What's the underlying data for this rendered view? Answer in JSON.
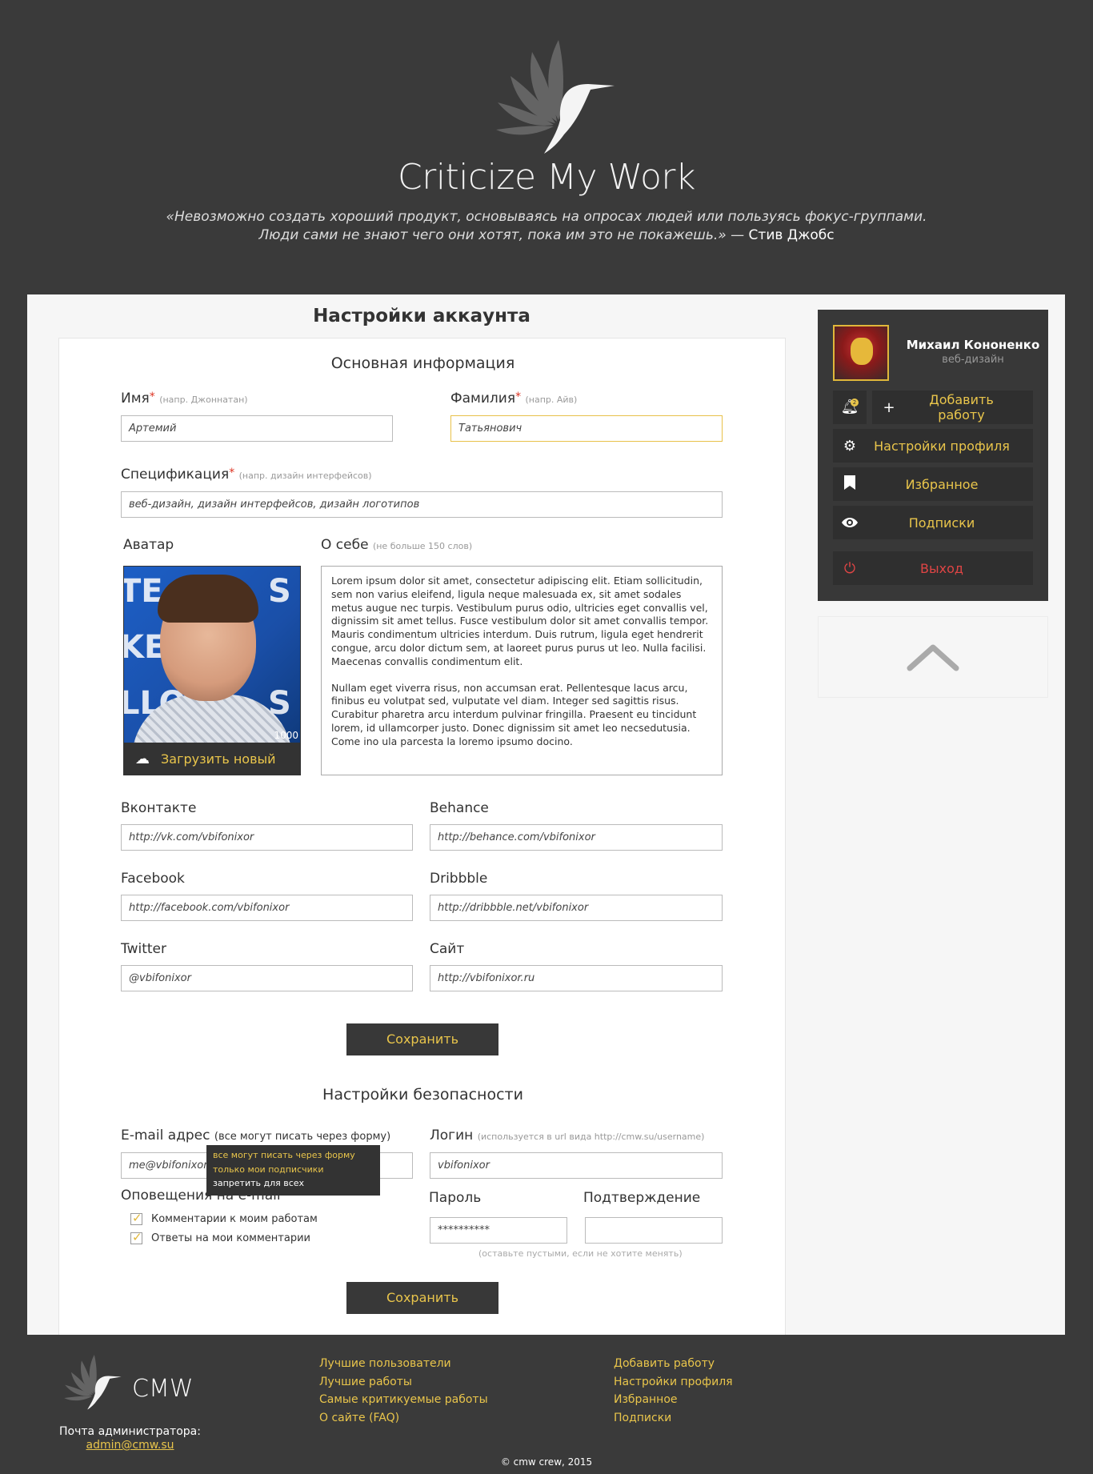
{
  "header": {
    "site_title": "Criticize My Work",
    "quote_text": "«Невозможно создать хороший продукт, основываясь на опросах людей или пользуясь фокус-группами. Люди сами не знают чего они хотят, пока им это не покажешь.» —",
    "quote_author": "Стив Джобс"
  },
  "page_title": "Настройки аккаунта",
  "basic": {
    "section_title": "Основная информация",
    "first_name_label": "Имя",
    "first_name_hint": "(напр. Джоннатан)",
    "first_name_value": "Артемий",
    "last_name_label": "Фамилия",
    "last_name_hint": "(напр. Айв)",
    "last_name_value": "Татьянович",
    "spec_label": "Спецификация",
    "spec_hint": "(напр. дизайн интерфейсов)",
    "spec_value": "веб-дизайн, дизайн интерфейсов, дизайн логотипов",
    "avatar_label": "Аватар",
    "avatar_badge": "1000",
    "upload_label": "Загрузить новый",
    "about_label": "О себе",
    "about_hint": "(не больше 150 слов)",
    "about_p1": "Lorem ipsum dolor sit amet, consectetur adipiscing elit. Etiam sollicitudin, sem non varius eleifend, ligula neque malesuada ex, sit amet sodales metus augue nec turpis. Vestibulum purus odio, ultricies eget convallis vel, dignissim sit amet tellus. Fusce vestibulum dolor sit amet convallis tempor. Mauris condimentum ultricies interdum. Duis rutrum, ligula eget hendrerit congue, arcu dolor dictum sem, at laoreet purus purus ut leo. Nulla facilisi. Maecenas convallis condimentum elit.",
    "about_p2": "Nullam eget viverra risus, non accumsan erat. Pellentesque lacus arcu, finibus eu volutpat sed, vulputate vel diam. Integer sed sagittis risus. Curabitur pharetra arcu interdum pulvinar fringilla. Praesent eu tincidunt lorem, id ullamcorper justo. Donec dignissim sit amet leo necsedutusia. Come ino ula parcesta la loremo ipsumo docino."
  },
  "social": {
    "vk_label": "Вконтакте",
    "vk_value": "http://vk.com/vbifonixor",
    "behance_label": "Behance",
    "behance_value": "http://behance.com/vbifonixor",
    "facebook_label": "Facebook",
    "facebook_value": "http://facebook.com/vbifonixor",
    "dribbble_label": "Dribbble",
    "dribbble_value": "http://dribbble.net/vbifonixor",
    "twitter_label": "Twitter",
    "twitter_value": "@vbifonixor",
    "site_label": "Сайт",
    "site_value": "http://vbifonixor.ru"
  },
  "save_label": "Сохранить",
  "security": {
    "section_title": "Настройки безопасности",
    "email_label": "E-mail адрес",
    "email_privacy_selected": "(все могут писать через форму)",
    "email_value": "me@vbifonixor.ru",
    "privacy_options": [
      "все могут писать через форму",
      "только мои подписчики",
      "запретить для всех"
    ],
    "login_label": "Логин",
    "login_hint": "(используется в url вида http://cmw.su/username)",
    "login_value": "vbifonixor",
    "notify_label": "Оповещения на e-mail",
    "notify_1": "Комментарии к моим работам",
    "notify_2": "Ответы на мои комментарии",
    "password_label": "Пароль",
    "password_value": "**********",
    "confirm_label": "Подтверждение",
    "confirm_value": "",
    "password_hint": "(оставьте пустыми, если не хотите менять)"
  },
  "sidebar": {
    "user_name": "Михаил Кононенко",
    "user_role": "веб-дизайн",
    "notif_count": "2",
    "add_work": "Добавить работу",
    "profile_settings": "Настройки профиля",
    "favorites": "Избранное",
    "subscriptions": "Подписки",
    "logout": "Выход"
  },
  "footer": {
    "brand": "CMW",
    "admin_mail_label": "Почта администратора:",
    "admin_mail": "admin@cmw.su",
    "col1": [
      "Лучшие пользователи",
      "Лучшие работы",
      "Самые критикуемые работы",
      "О сайте (FAQ)"
    ],
    "col2": [
      "Добавить работу",
      "Настройки профиля",
      "Избранное",
      "Подписки"
    ],
    "copyright": "© cmw crew, 2015"
  },
  "colors": {
    "accent": "#e9c54b",
    "dark": "#3a3a3a",
    "danger": "#e04545"
  }
}
